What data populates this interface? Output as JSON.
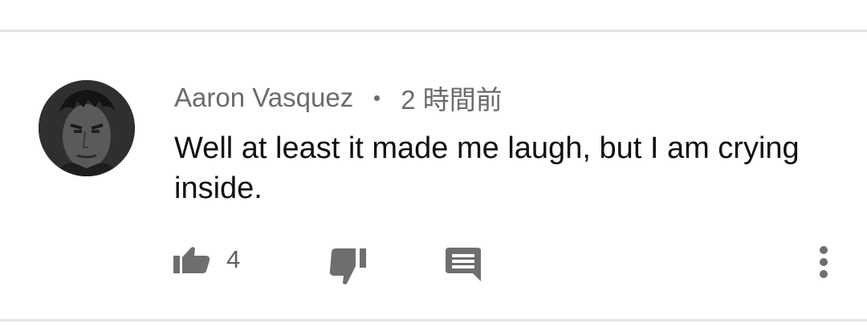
{
  "comment": {
    "author": "Aaron Vasquez",
    "timestamp": "2 時間前",
    "text": "Well at least it made me laugh, but I am crying inside.",
    "like_count": "4"
  },
  "icons": {
    "avatar": "avatar-image",
    "like": "thumb-up-icon",
    "dislike": "thumb-down-icon",
    "reply": "comment-reply-icon",
    "more": "more-vert-icon"
  },
  "colors": {
    "text_primary": "#111111",
    "text_secondary": "#6b6b6b",
    "icon": "#6e6e6e",
    "divider": "#e3e3e3"
  }
}
